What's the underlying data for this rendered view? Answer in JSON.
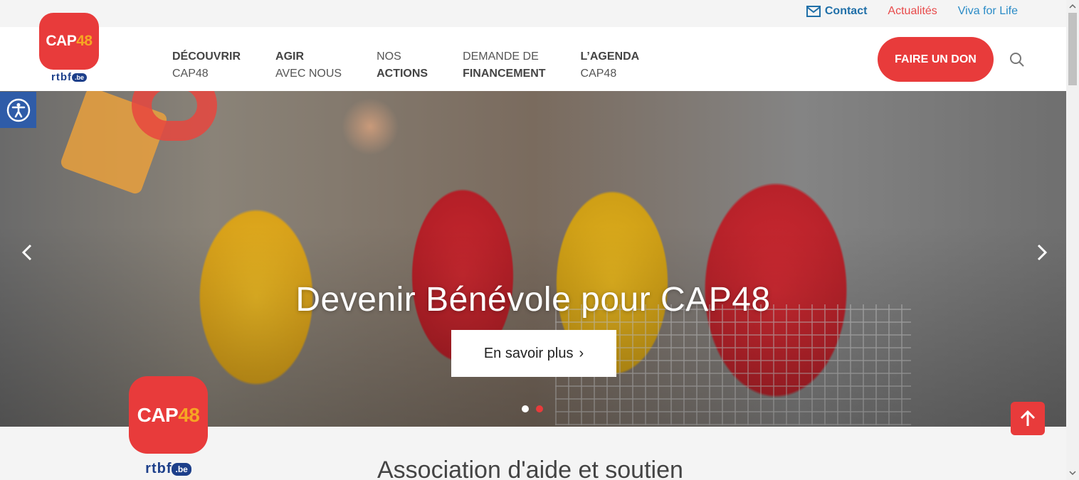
{
  "topbar": {
    "contact": "Contact",
    "news": "Actualités",
    "viva": "Viva for Life"
  },
  "logo": {
    "cap": "CAP",
    "num": "48",
    "rtbf": "rtbf",
    "be": ".be"
  },
  "nav": [
    {
      "l1": "DÉCOUVRIR",
      "l2": "CAP48"
    },
    {
      "l1": "AGIR",
      "l2": "AVEC NOUS"
    },
    {
      "l1": "NOS",
      "l2": "ACTIONS"
    },
    {
      "l1": "DEMANDE DE",
      "l2": "FINANCEMENT"
    },
    {
      "l1": "L’AGENDA",
      "l2": "CAP48"
    }
  ],
  "header": {
    "donate": "FAIRE UN DON"
  },
  "hero": {
    "title": "Devenir Bénévole pour CAP48",
    "button": "En savoir plus",
    "button_chevron": "›",
    "slides_total": 2,
    "slide_active": 2
  },
  "section": {
    "title": "Association d'aide et soutien"
  },
  "colors": {
    "brand_red": "#e83b3b",
    "brand_orange": "#f6a623",
    "rtbf_blue": "#1d3f8a",
    "link_blue": "#2a8bc7"
  },
  "icons": [
    "mail-icon",
    "search-icon",
    "accessibility-icon",
    "chevron-left-icon",
    "chevron-right-icon",
    "arrow-up-icon"
  ]
}
